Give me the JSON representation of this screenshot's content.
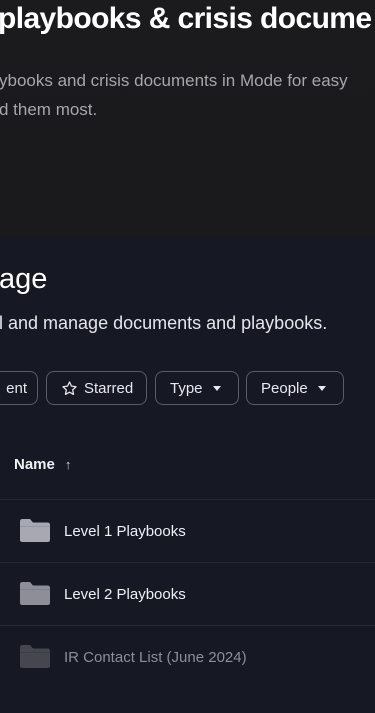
{
  "hero": {
    "title": "playbooks & crisis docume",
    "description_lines": [
      "ybooks and crisis documents in Mode for easy",
      "d them most."
    ]
  },
  "manage": {
    "title": "age",
    "subtitle": "l and manage documents and playbooks."
  },
  "filters": {
    "recent_label": "ent",
    "starred_label": "Starred",
    "type_label": "Type",
    "people_label": "People"
  },
  "table": {
    "name_header": "Name",
    "sort_icon": "arrow-up-icon",
    "rows": [
      {
        "label": "Level 1 Playbooks",
        "icon": "folder-icon"
      },
      {
        "label": "Level 2 Playbooks",
        "icon": "folder-icon"
      },
      {
        "label": "IR Contact List (June 2024)",
        "icon": "folder-icon"
      }
    ]
  },
  "colors": {
    "background": "#161823",
    "hero_background": "#1b1b1d",
    "folder": "#a8a8b2"
  }
}
